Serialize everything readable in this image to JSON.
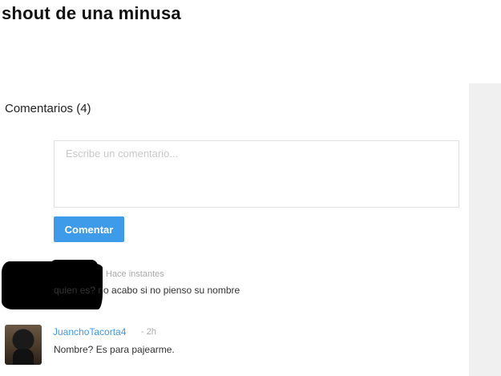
{
  "post": {
    "title": "shout de una minusa"
  },
  "comments_section": {
    "heading": "Comentarios (4)",
    "input_placeholder": "Escribe un comentario...",
    "submit_label": "Comentar"
  },
  "comments": [
    {
      "author": "",
      "author_censored": true,
      "time": "Hace instantes",
      "text": "quien es? no acabo si no pienso su nombre"
    },
    {
      "author": "JuanchoTacorta4",
      "time": "- 2h",
      "text": "Nombre? Es para pajearme."
    }
  ],
  "colors": {
    "accent": "#3d9be9",
    "sidebar_bg": "#f0f0f0",
    "muted_text": "#aaaaaa"
  }
}
